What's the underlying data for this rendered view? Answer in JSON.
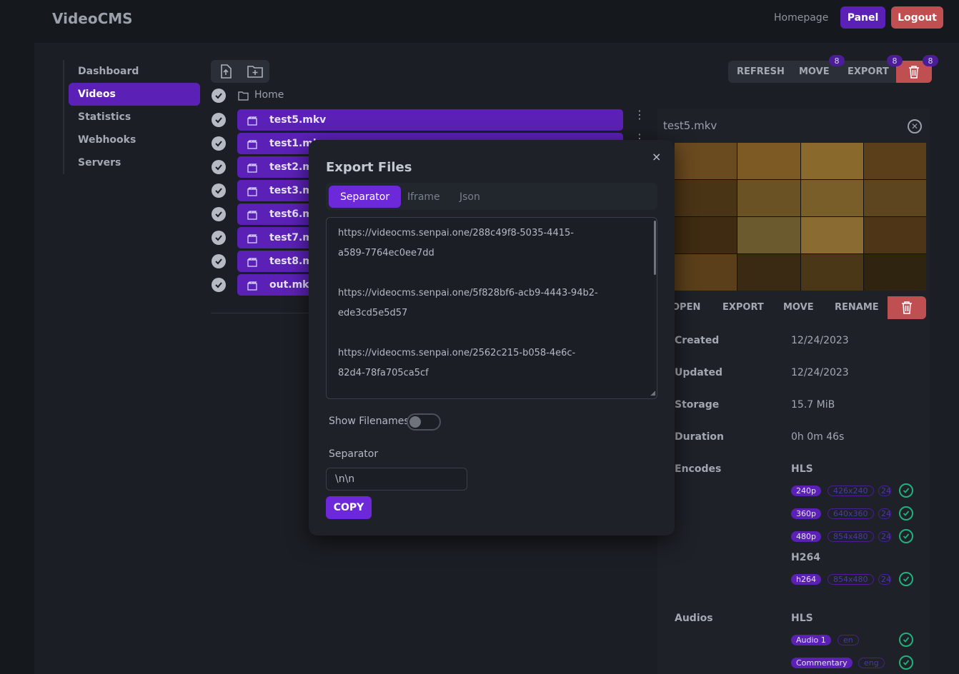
{
  "header": {
    "brand": "VideoCMS",
    "nav_homepage": "Homepage",
    "panel_label": "Panel",
    "logout_label": "Logout"
  },
  "sidebar": {
    "items": [
      {
        "label": "Dashboard",
        "active": false
      },
      {
        "label": "Videos",
        "active": true
      },
      {
        "label": "Statistics",
        "active": false
      },
      {
        "label": "Webhooks",
        "active": false
      },
      {
        "label": "Servers",
        "active": false
      }
    ]
  },
  "browser": {
    "breadcrumb": "Home",
    "files": [
      "test5.mkv",
      "test1.mkv",
      "test2.mkv",
      "test3.mkv",
      "test6.mkv",
      "test7.mkv",
      "test8.mkv",
      "out.mkv"
    ]
  },
  "actions": {
    "refresh": "REFRESH",
    "move": "MOVE",
    "export": "EXPORT",
    "move_badge": "8",
    "export_badge": "8",
    "delete_badge": "8"
  },
  "detail": {
    "title": "test5.mkv",
    "actions": {
      "open": "OPEN",
      "export": "EXPORT",
      "move": "MOVE",
      "rename": "RENAME"
    },
    "props": {
      "created_label": "Created",
      "created": "12/24/2023",
      "updated_label": "Updated",
      "updated": "12/24/2023",
      "storage_label": "Storage",
      "storage": "15.7 MiB",
      "duration_label": "Duration",
      "duration": "0h 0m 46s",
      "encodes_label": "Encodes",
      "audios_label": "Audios"
    },
    "encodes": {
      "hls_label": "HLS",
      "hls": [
        {
          "quality": "240p",
          "res": "426x240",
          "fps": "24"
        },
        {
          "quality": "360p",
          "res": "640x360",
          "fps": "24"
        },
        {
          "quality": "480p",
          "res": "854x480",
          "fps": "24"
        }
      ],
      "h264_label": "H264",
      "h264": [
        {
          "quality": "h264",
          "res": "854x480",
          "fps": "24"
        }
      ]
    },
    "audios": {
      "hls_label": "HLS",
      "items": [
        {
          "name": "Audio 1",
          "lang": "en"
        },
        {
          "name": "Commentary",
          "lang": "eng"
        }
      ]
    }
  },
  "modal": {
    "title": "Export Files",
    "close": "×",
    "tabs": [
      "Separator",
      "Iframe",
      "Json"
    ],
    "urls": [
      "https://videocms.senpai.one/288c49f8-5035-4415-\na589-7764ec0ee7dd",
      "https://videocms.senpai.one/5f828bf6-acb9-4443-94b2-\nede3cd5e5d57",
      "https://videocms.senpai.one/2562c215-b058-4e6c-\n82d4-78fa705ca5cf"
    ],
    "show_filenames_label": "Show Filenames",
    "show_filenames": false,
    "separator_label": "Separator",
    "separator_value": "\\n\\n",
    "copy_label": "COPY"
  },
  "colors": {
    "accent": "#5b21b6",
    "danger": "#c04f52",
    "success": "#22b07d"
  }
}
